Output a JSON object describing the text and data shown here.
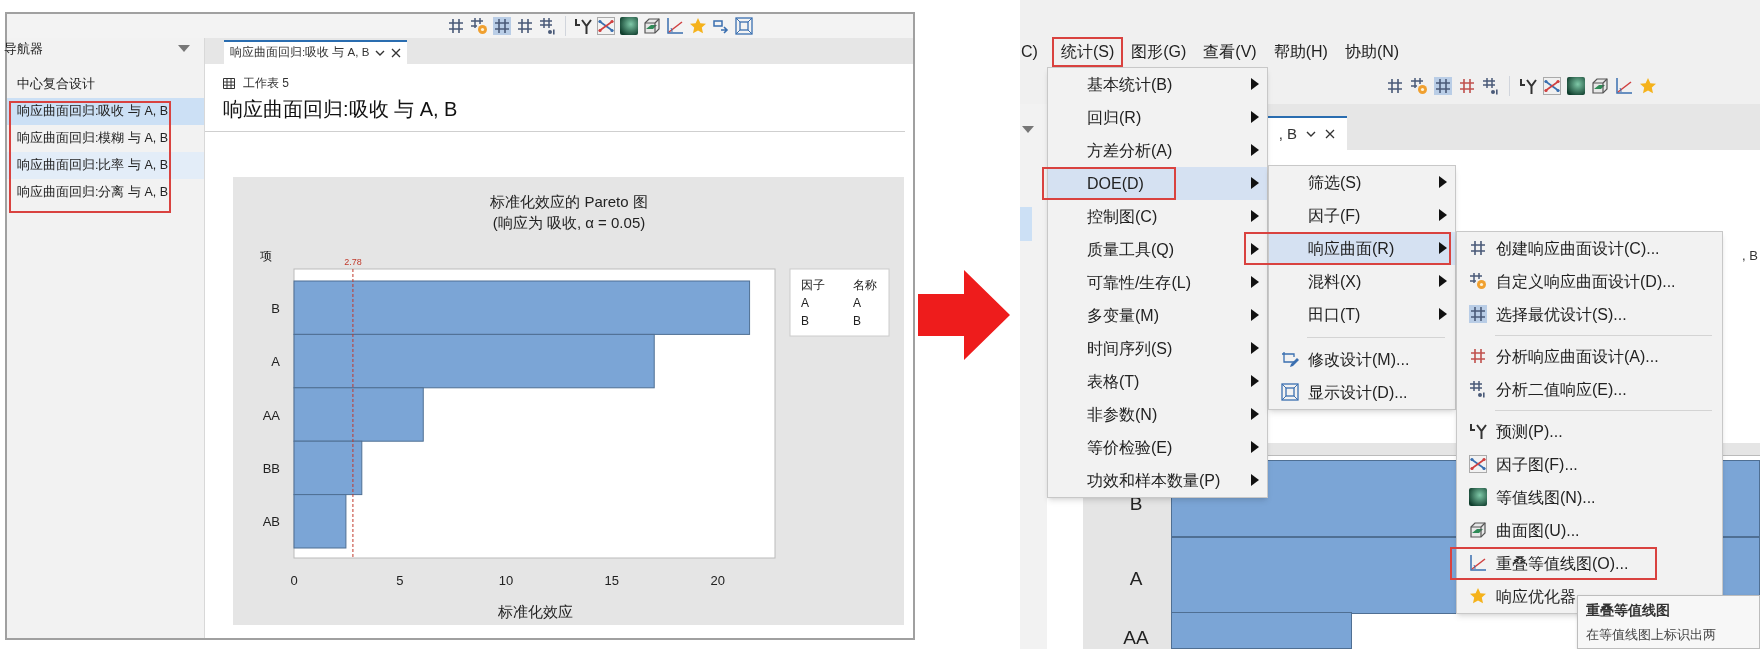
{
  "left_screen": {
    "navigator": {
      "title": "导航器",
      "items": [
        {
          "label": "中心复合设计",
          "selected": false,
          "hovered": false,
          "boxed": false
        },
        {
          "label": "响应曲面回归:吸收 与 A, B",
          "selected": true,
          "hovered": false,
          "boxed": true
        },
        {
          "label": "响应曲面回归:模糊 与 A, B",
          "selected": false,
          "hovered": false,
          "boxed": true
        },
        {
          "label": "响应曲面回归:比率 与 A, B",
          "selected": false,
          "hovered": true,
          "boxed": true
        },
        {
          "label": "响应曲面回归:分离 与 A, B",
          "selected": false,
          "hovered": false,
          "boxed": true
        }
      ]
    },
    "tab": {
      "label": "响应曲面回归:吸收 与 A, B"
    },
    "worksheet": "工作表 5",
    "title": "响应曲面回归:吸收 与 A, B",
    "chart": {
      "chart_data": {
        "type": "bar",
        "orientation": "horizontal",
        "title": "标准化效应的 Pareto 图",
        "subtitle": "(响应为 吸收, α = 0.05)",
        "xlabel": "标准化效应",
        "ylabel": "项",
        "categories": [
          "B",
          "A",
          "AA",
          "BB",
          "AB"
        ],
        "values": [
          21.5,
          17.0,
          6.1,
          3.2,
          2.45
        ],
        "xlim": [
          0,
          22.7
        ],
        "xticks": [
          0,
          5,
          10,
          15,
          20
        ],
        "ref_lines": [
          {
            "axis": "x",
            "value": 2.78,
            "label": "2.78"
          }
        ]
      }
    },
    "legend": {
      "columns": [
        "因子",
        "名称"
      ],
      "rows": [
        [
          "A",
          "A"
        ],
        [
          "B",
          "B"
        ]
      ]
    }
  },
  "right_screen": {
    "menu_bar": [
      {
        "label": "C)",
        "boxed": false
      },
      {
        "label": "统计(S)",
        "boxed": true
      },
      {
        "label": "图形(G)",
        "boxed": false
      },
      {
        "label": "查看(V)",
        "boxed": false
      },
      {
        "label": "帮助(H)",
        "boxed": false
      },
      {
        "label": "协助(N)",
        "boxed": false
      }
    ],
    "background_tab": {
      "label": ", B"
    },
    "edge_text": ", B",
    "background_chart": {
      "labels": [
        "B",
        "A",
        "AA"
      ]
    },
    "stat_menu": {
      "items": [
        {
          "label": "基本统计(B)",
          "selected": false,
          "boxed": false
        },
        {
          "label": "回归(R)",
          "selected": false,
          "boxed": false
        },
        {
          "label": "方差分析(A)",
          "selected": false,
          "boxed": false
        },
        {
          "label": "DOE(D)",
          "selected": true,
          "boxed": true
        },
        {
          "label": "控制图(C)",
          "selected": false,
          "boxed": false
        },
        {
          "label": "质量工具(Q)",
          "selected": false,
          "boxed": false
        },
        {
          "label": "可靠性/生存(L)",
          "selected": false,
          "boxed": false
        },
        {
          "label": "多变量(M)",
          "selected": false,
          "boxed": false
        },
        {
          "label": "时间序列(S)",
          "selected": false,
          "boxed": false
        },
        {
          "label": "表格(T)",
          "selected": false,
          "boxed": false
        },
        {
          "label": "非参数(N)",
          "selected": false,
          "boxed": false
        },
        {
          "label": "等价检验(E)",
          "selected": false,
          "boxed": false
        },
        {
          "label": "功效和样本数量(P)",
          "selected": false,
          "boxed": false
        }
      ]
    },
    "doe_menu": {
      "items": [
        {
          "kind": "submenu",
          "label": "筛选(S)",
          "selected": false,
          "boxed": false
        },
        {
          "kind": "submenu",
          "label": "因子(F)",
          "selected": false,
          "boxed": false
        },
        {
          "kind": "submenu",
          "label": "响应曲面(R)",
          "selected": true,
          "boxed": true
        },
        {
          "kind": "submenu",
          "label": "混料(X)",
          "selected": false,
          "boxed": false
        },
        {
          "kind": "submenu",
          "label": "田口(T)",
          "selected": false,
          "boxed": false
        },
        {
          "kind": "separator"
        },
        {
          "kind": "command",
          "label": "修改设计(M)...",
          "selected": false,
          "boxed": false
        },
        {
          "kind": "command",
          "label": "显示设计(D)...",
          "selected": false,
          "boxed": false
        }
      ]
    },
    "response_surface_menu": {
      "items": [
        {
          "kind": "command",
          "label": "创建响应曲面设计(C)...",
          "selected": false,
          "boxed": false
        },
        {
          "kind": "command",
          "label": "自定义响应曲面设计(D)...",
          "selected": false,
          "boxed": false
        },
        {
          "kind": "command",
          "label": "选择最优设计(S)...",
          "selected": false,
          "boxed": false
        },
        {
          "kind": "separator"
        },
        {
          "kind": "command",
          "label": "分析响应曲面设计(A)...",
          "selected": false,
          "boxed": false
        },
        {
          "kind": "command",
          "label": "分析二值响应(E)...",
          "selected": false,
          "boxed": false
        },
        {
          "kind": "separator"
        },
        {
          "kind": "command",
          "label": "预测(P)...",
          "selected": false,
          "boxed": false
        },
        {
          "kind": "command",
          "label": "因子图(F)...",
          "selected": false,
          "boxed": false
        },
        {
          "kind": "command",
          "label": "等值线图(N)...",
          "selected": false,
          "boxed": false
        },
        {
          "kind": "command",
          "label": "曲面图(U)...",
          "selected": false,
          "boxed": false
        },
        {
          "kind": "command",
          "label": "重叠等值线图(O)...",
          "selected": false,
          "boxed": true
        },
        {
          "kind": "command",
          "label": "响应优化器",
          "selected": false,
          "boxed": false
        }
      ]
    },
    "tooltip": {
      "title": "重叠等值线图",
      "text": "在等值线图上标识出两"
    }
  }
}
